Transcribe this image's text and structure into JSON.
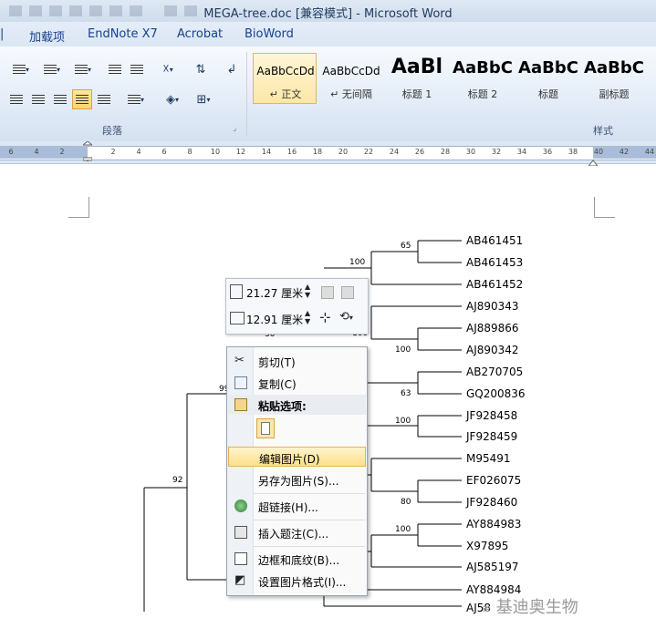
{
  "window": {
    "title": "MEGA-tree.doc [兼容模式] - Microsoft Word"
  },
  "tabs": [
    "加载项",
    "EndNote X7",
    "Acrobat",
    "BioWord"
  ],
  "ribbon": {
    "paragraph_group_label": "段落",
    "styles_group_label": "样式",
    "styles": [
      {
        "sample": "AaBbCcDd",
        "name": "↵ 正文"
      },
      {
        "sample": "AaBbCcDd",
        "name": "↵ 无间隔"
      },
      {
        "sample": "AaBl",
        "name": "标题 1"
      },
      {
        "sample": "AaBbC",
        "name": "标题 2"
      },
      {
        "sample": "AaBbC",
        "name": "标题"
      },
      {
        "sample": "AaBbC",
        "name": "副标题"
      }
    ]
  },
  "ruler": {
    "ticks": [
      "6",
      "4",
      "2",
      "",
      "2",
      "4",
      "6",
      "8",
      "10",
      "12",
      "14",
      "16",
      "18",
      "20",
      "22",
      "24",
      "26",
      "28",
      "30",
      "32",
      "34",
      "36",
      "38",
      "40",
      "42",
      "44"
    ]
  },
  "tree": {
    "leaves": [
      "AB461451",
      "AB461453",
      "AB461452",
      "AJ890343",
      "AJ889866",
      "AJ890342",
      "AB270705",
      "GQ200836",
      "JF928458",
      "JF928459",
      "M95491",
      "EF026075",
      "JF928460",
      "AY884983",
      "X97895",
      "AJ585197",
      "AY884984",
      "AJ58"
    ],
    "bootstraps": {
      "b65": "65",
      "b100a": "100",
      "b30": "30",
      "b100b": "100",
      "b100c": "100",
      "b63": "63",
      "b99": "99",
      "b100d": "100",
      "b92": "92",
      "b80": "80",
      "b100e": "100"
    }
  },
  "mini_toolbar": {
    "height": "21.27 厘米",
    "width": "12.91 厘米"
  },
  "context_menu": {
    "cut": "剪切(T)",
    "copy": "复制(C)",
    "paste_options": "粘贴选项:",
    "edit_picture": "编辑图片(D)",
    "save_as_picture": "另存为图片(S)...",
    "hyperlink": "超链接(H)...",
    "insert_caption": "插入题注(C)...",
    "borders_shading": "边框和底纹(B)...",
    "format_picture": "设置图片格式(I)..."
  },
  "watermark": "基迪奥生物"
}
